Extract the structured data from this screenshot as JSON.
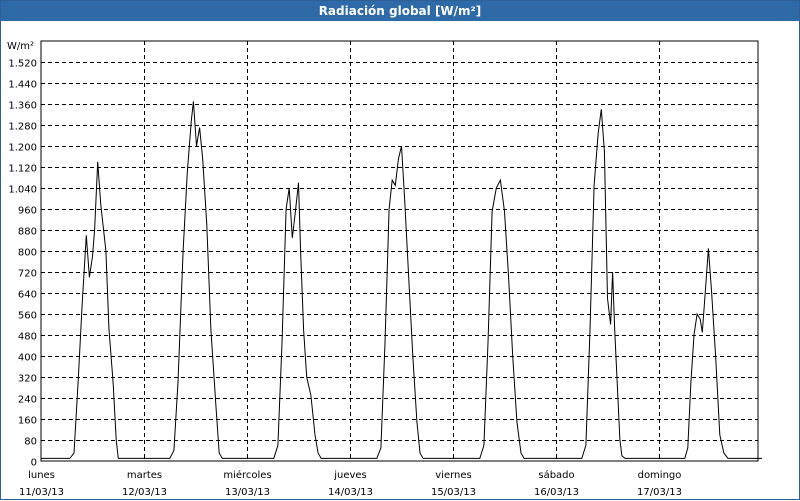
{
  "window": {
    "title": "Radiación global [W/m²]"
  },
  "chart_data": {
    "type": "line",
    "ylabel": "W/m²",
    "ylim": [
      0,
      1600
    ],
    "yticks": [
      "0",
      "80",
      "160",
      "240",
      "320",
      "400",
      "480",
      "560",
      "640",
      "720",
      "800",
      "880",
      "960",
      "1.040",
      "1.120",
      "1.200",
      "1.280",
      "1.360",
      "1.440",
      "1.520"
    ],
    "ytick_values": [
      0,
      80,
      160,
      240,
      320,
      400,
      480,
      560,
      640,
      720,
      800,
      880,
      960,
      1040,
      1120,
      1200,
      1280,
      1360,
      1440,
      1520
    ],
    "xlim": [
      0,
      7
    ],
    "x_categories": [
      {
        "day": "lunes",
        "date": "11/03/13"
      },
      {
        "day": "martes",
        "date": "12/03/13"
      },
      {
        "day": "miércoles",
        "date": "13/03/13"
      },
      {
        "day": "jueves",
        "date": "14/03/13"
      },
      {
        "day": "viernes",
        "date": "15/03/13"
      },
      {
        "day": "sábado",
        "date": "16/03/13"
      },
      {
        "day": "domingo",
        "date": "17/03/13"
      }
    ],
    "grid": true,
    "series": [
      {
        "color": "#000000",
        "points": [
          [
            0.0,
            10
          ],
          [
            0.28,
            10
          ],
          [
            0.32,
            30
          ],
          [
            0.36,
            300
          ],
          [
            0.4,
            600
          ],
          [
            0.44,
            860
          ],
          [
            0.47,
            700
          ],
          [
            0.5,
            780
          ],
          [
            0.52,
            880
          ],
          [
            0.55,
            1140
          ],
          [
            0.58,
            980
          ],
          [
            0.63,
            800
          ],
          [
            0.66,
            500
          ],
          [
            0.7,
            300
          ],
          [
            0.73,
            80
          ],
          [
            0.75,
            10
          ],
          [
            0.78,
            10
          ],
          [
            1.0,
            10
          ],
          [
            1.25,
            10
          ],
          [
            1.29,
            40
          ],
          [
            1.33,
            300
          ],
          [
            1.38,
            800
          ],
          [
            1.42,
            1100
          ],
          [
            1.46,
            1300
          ],
          [
            1.48,
            1370
          ],
          [
            1.51,
            1200
          ],
          [
            1.54,
            1270
          ],
          [
            1.57,
            1150
          ],
          [
            1.61,
            900
          ],
          [
            1.65,
            500
          ],
          [
            1.7,
            200
          ],
          [
            1.73,
            30
          ],
          [
            1.76,
            10
          ],
          [
            2.0,
            10
          ],
          [
            2.26,
            10
          ],
          [
            2.3,
            60
          ],
          [
            2.34,
            450
          ],
          [
            2.38,
            960
          ],
          [
            2.41,
            1040
          ],
          [
            2.44,
            850
          ],
          [
            2.47,
            950
          ],
          [
            2.5,
            1060
          ],
          [
            2.52,
            800
          ],
          [
            2.55,
            500
          ],
          [
            2.58,
            320
          ],
          [
            2.62,
            250
          ],
          [
            2.66,
            100
          ],
          [
            2.69,
            30
          ],
          [
            2.72,
            10
          ],
          [
            3.0,
            10
          ],
          [
            3.26,
            10
          ],
          [
            3.3,
            50
          ],
          [
            3.34,
            450
          ],
          [
            3.38,
            960
          ],
          [
            3.41,
            1070
          ],
          [
            3.44,
            1050
          ],
          [
            3.47,
            1150
          ],
          [
            3.5,
            1200
          ],
          [
            3.53,
            1000
          ],
          [
            3.57,
            700
          ],
          [
            3.61,
            400
          ],
          [
            3.65,
            150
          ],
          [
            3.68,
            30
          ],
          [
            3.71,
            10
          ],
          [
            4.0,
            10
          ],
          [
            4.26,
            10
          ],
          [
            4.3,
            60
          ],
          [
            4.34,
            450
          ],
          [
            4.38,
            950
          ],
          [
            4.42,
            1040
          ],
          [
            4.46,
            1070
          ],
          [
            4.5,
            950
          ],
          [
            4.54,
            700
          ],
          [
            4.58,
            400
          ],
          [
            4.62,
            150
          ],
          [
            4.66,
            30
          ],
          [
            4.69,
            10
          ],
          [
            5.0,
            10
          ],
          [
            5.25,
            10
          ],
          [
            5.29,
            60
          ],
          [
            5.33,
            500
          ],
          [
            5.37,
            1050
          ],
          [
            5.41,
            1250
          ],
          [
            5.44,
            1340
          ],
          [
            5.47,
            1180
          ],
          [
            5.5,
            620
          ],
          [
            5.53,
            520
          ],
          [
            5.55,
            720
          ],
          [
            5.57,
            500
          ],
          [
            5.6,
            250
          ],
          [
            5.62,
            80
          ],
          [
            5.64,
            20
          ],
          [
            5.67,
            10
          ],
          [
            6.0,
            10
          ],
          [
            6.25,
            10
          ],
          [
            6.28,
            50
          ],
          [
            6.31,
            300
          ],
          [
            6.34,
            480
          ],
          [
            6.37,
            560
          ],
          [
            6.4,
            540
          ],
          [
            6.42,
            490
          ],
          [
            6.45,
            650
          ],
          [
            6.48,
            810
          ],
          [
            6.51,
            650
          ],
          [
            6.55,
            400
          ],
          [
            6.59,
            100
          ],
          [
            6.63,
            30
          ],
          [
            6.67,
            10
          ],
          [
            6.8,
            10
          ],
          [
            7.0,
            10
          ]
        ]
      }
    ]
  }
}
